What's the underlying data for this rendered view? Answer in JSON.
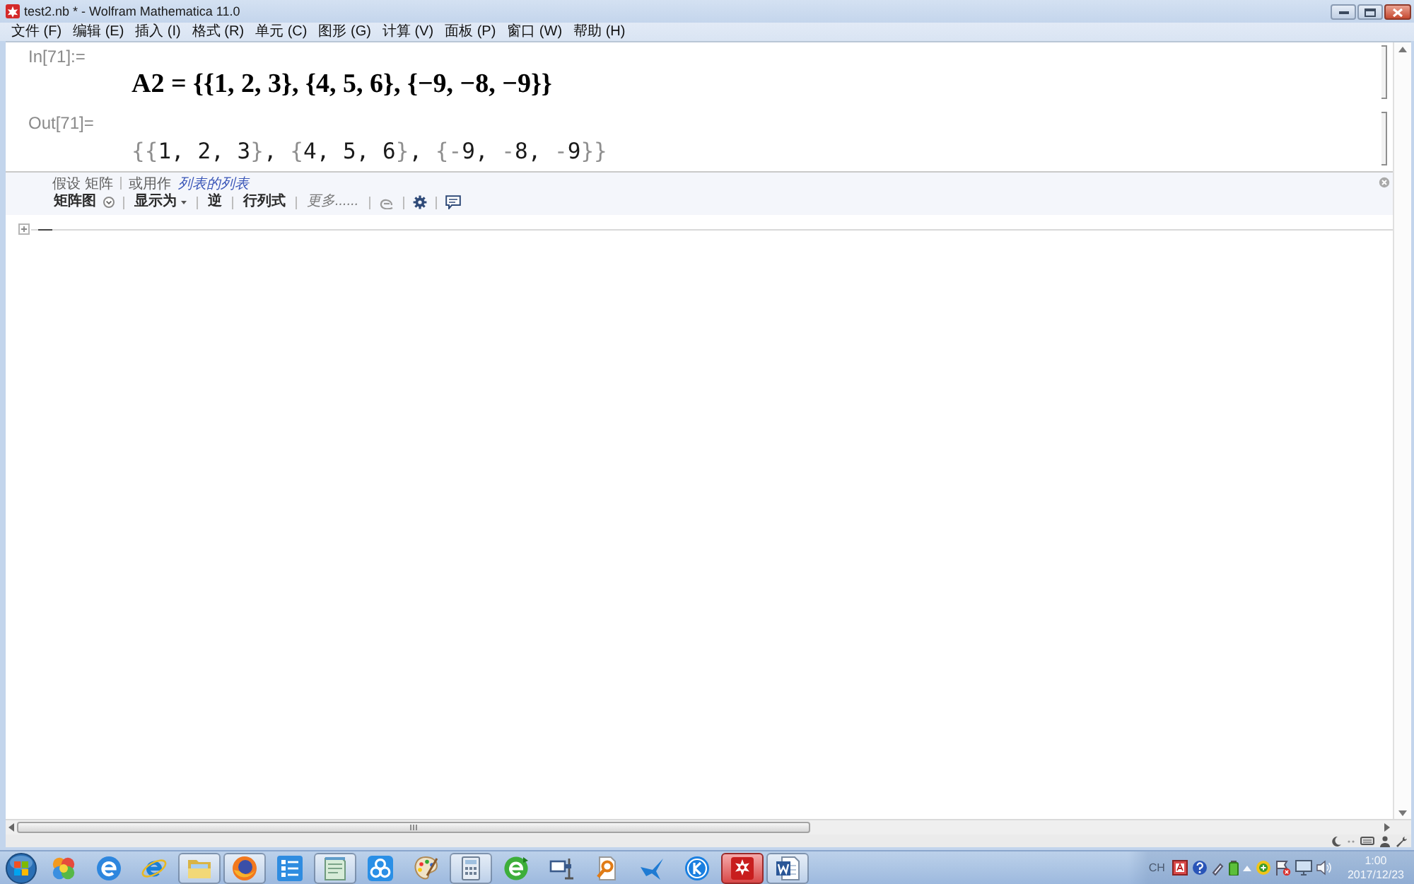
{
  "window": {
    "title": "test2.nb * - Wolfram Mathematica 11.0"
  },
  "menu_bar": {
    "items": [
      "文件 (F)",
      "编辑 (E)",
      "插入 (I)",
      "格式 (R)",
      "单元 (C)",
      "图形 (G)",
      "计算 (V)",
      "面板 (P)",
      "窗口 (W)",
      "帮助 (H)"
    ]
  },
  "notebook": {
    "cells": [
      {
        "kind": "input",
        "label": "In[71]:=",
        "content": "A2 = {{1, 2, 3}, {4, 5, 6}, {−9, −8, −9}}"
      },
      {
        "kind": "output",
        "label": "Out[71]=",
        "content": "{{1, 2, 3}, {4, 5, 6}, {-9, -8, -9}}"
      }
    ],
    "suggestions_bar": {
      "interpretation": "假设 矩阵",
      "alternative_prefix": "或用作",
      "alternative_link": "列表的列表",
      "actions": [
        {
          "kind": "menu_button",
          "label": "矩阵图"
        },
        {
          "kind": "dropdown",
          "label": "显示为"
        },
        {
          "kind": "button",
          "label": "逆"
        },
        {
          "kind": "button",
          "label": "行列式"
        },
        {
          "kind": "more",
          "label": "更多......"
        }
      ]
    }
  },
  "taskbar": {
    "items": [
      {
        "kind": "circles_cluster",
        "running": false,
        "selected": false
      },
      {
        "kind": "e_globe",
        "running": false,
        "selected": false
      },
      {
        "kind": "e_ring",
        "running": false,
        "selected": false
      },
      {
        "kind": "folder",
        "running": true,
        "selected": false
      },
      {
        "kind": "flame_circle",
        "running": true,
        "selected": false
      },
      {
        "kind": "list",
        "running": false,
        "selected": false
      },
      {
        "kind": "notepad",
        "running": true,
        "selected": false
      },
      {
        "kind": "rings",
        "running": false,
        "selected": false
      },
      {
        "kind": "palette",
        "running": false,
        "selected": false
      },
      {
        "kind": "calculator",
        "running": true,
        "selected": false
      },
      {
        "kind": "refresh_e",
        "running": false,
        "selected": false
      },
      {
        "kind": "screen_stand",
        "running": false,
        "selected": false
      },
      {
        "kind": "magnifier_document",
        "running": false,
        "selected": false
      },
      {
        "kind": "bird",
        "running": false,
        "selected": false
      },
      {
        "kind": "k_circle",
        "running": false,
        "selected": false
      },
      {
        "kind": "star_gear",
        "running": true,
        "selected": true
      },
      {
        "kind": "w_document",
        "running": true,
        "selected": false
      }
    ],
    "tray": {
      "language": "CH",
      "time": "1:00",
      "date": "2017/12/23"
    }
  }
}
